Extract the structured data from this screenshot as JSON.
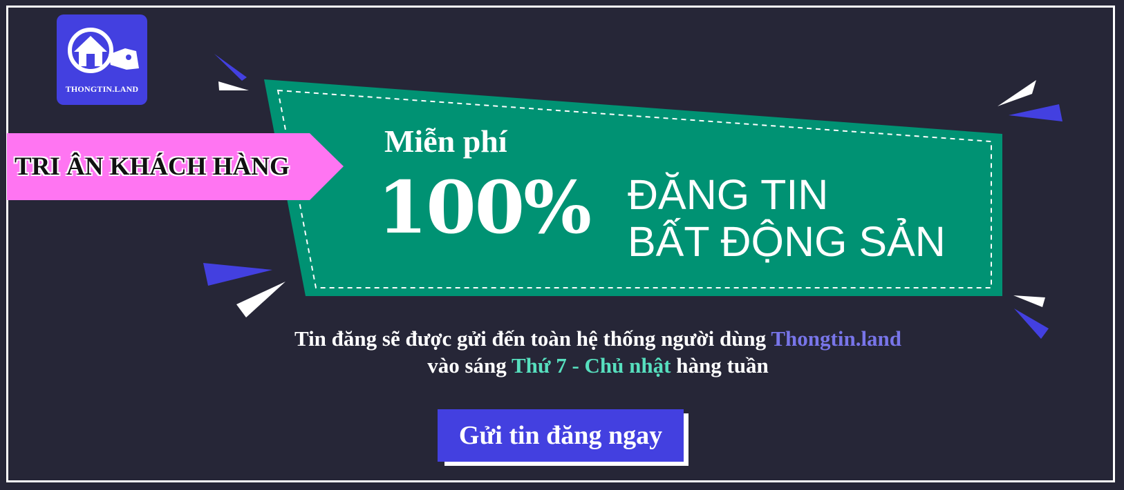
{
  "brand": {
    "logo_text": "THONGTIN.LAND",
    "icons": [
      "house-search-icon"
    ]
  },
  "banner": {
    "ribbon_text": "TRI ÂN KHÁCH HÀNG",
    "free_label": "Miễn phí",
    "percent_text": "100%",
    "headline_line1": "ĐĂNG TIN",
    "headline_line2": "BẤT ĐỘNG SẢN"
  },
  "message": {
    "line1_prefix": "Tin đăng sẽ được gửi đến toàn hệ thống người dùng ",
    "brand_name": "Thongtin.land",
    "line2_prefix": "vào sáng ",
    "days": "Thứ 7 - Chủ nhật",
    "line2_suffix": " hàng tuần"
  },
  "cta": {
    "label": "Gửi tin đăng ngay"
  },
  "colors": {
    "background": "#262637",
    "teal_panel": "#009273",
    "pink_ribbon": "#ff75f2",
    "accent_blue": "#4340e0",
    "brand_text": "#7875e9",
    "days_text": "#57dfbe",
    "white": "#ffffff"
  }
}
